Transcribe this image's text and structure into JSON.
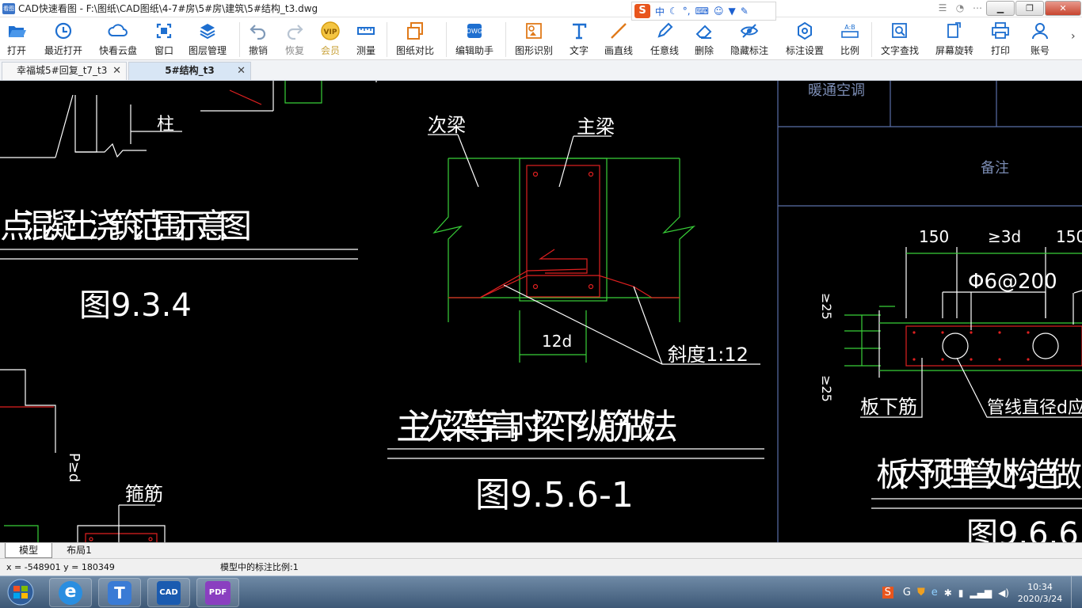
{
  "window": {
    "title": "CAD快速看图 - F:\\图纸\\CAD图纸\\4-7#房\\5#房\\建筑\\5#结构_t3.dwg",
    "app_logo": "看图"
  },
  "ime": {
    "logo": "S",
    "mode": "中"
  },
  "toolbar": {
    "items": [
      {
        "label": "打开",
        "icon": "folder-open-icon"
      },
      {
        "label": "最近打开",
        "icon": "recent-icon"
      },
      {
        "label": "快看云盘",
        "icon": "cloud-icon"
      },
      {
        "label": "窗口",
        "icon": "window-icon"
      },
      {
        "label": "图层管理",
        "icon": "layers-icon"
      },
      {
        "label": "撤销",
        "icon": "undo-icon"
      },
      {
        "label": "恢复",
        "icon": "redo-icon"
      },
      {
        "label": "会员",
        "icon": "vip-icon",
        "badge": "VIP"
      },
      {
        "label": "测量",
        "icon": "ruler-icon"
      },
      {
        "label": "图纸对比",
        "icon": "compare-icon"
      },
      {
        "label": "编辑助手",
        "icon": "edit-assistant-icon"
      },
      {
        "label": "图形识别",
        "icon": "shape-recognize-icon"
      },
      {
        "label": "文字",
        "icon": "text-icon"
      },
      {
        "label": "画直线",
        "icon": "line-icon"
      },
      {
        "label": "任意线",
        "icon": "pen-icon"
      },
      {
        "label": "删除",
        "icon": "eraser-icon"
      },
      {
        "label": "隐藏标注",
        "icon": "hide-icon"
      },
      {
        "label": "标注设置",
        "icon": "settings-icon"
      },
      {
        "label": "比例",
        "icon": "scale-icon",
        "badge": "A:B"
      },
      {
        "label": "文字查找",
        "icon": "text-search-icon"
      },
      {
        "label": "屏幕旋转",
        "icon": "rotate-icon"
      },
      {
        "label": "打印",
        "icon": "print-icon"
      },
      {
        "label": "账号",
        "icon": "account-icon"
      }
    ]
  },
  "tabs": [
    {
      "label": "幸福城5#回复_t7_t3",
      "active": false
    },
    {
      "label": "5#结构_t3",
      "active": true
    }
  ],
  "drawing": {
    "left_title": "点混凝土浇筑范围示意图",
    "left_fig": "图9.3.4",
    "column_label": "柱",
    "stirrup_label": "箍筋",
    "side_label": "P≥d",
    "secondary_beam": "次梁",
    "main_beam": "主梁",
    "dim_12d": "12d",
    "slope": "斜度1:12",
    "center_title": "主次梁等高时梁下纵筋做法",
    "center_fig": "图9.5.6-1",
    "hvac": "暖通空调",
    "remarks": "备注",
    "dim_150_left": "150",
    "dim_3d": "≥3d",
    "dim_150_right": "150",
    "rebar_spec": "Φ6@200",
    "dim_25_top": "≥25",
    "dim_25_bottom": "≥25",
    "slab_bottom_bar": "板下筋",
    "pipe_note": "管线直径d应≤",
    "right_title": "板内预埋管处构造做",
    "right_fig": "图9.6.6"
  },
  "layout_tabs": [
    {
      "label": "模型",
      "active": true
    },
    {
      "label": "布局1",
      "active": false
    }
  ],
  "status": {
    "coords": "x = -548901  y = 180349",
    "scale_text": "模型中的标注比例:1"
  },
  "taskbar": {
    "apps": [
      {
        "name": "ie",
        "label": "e"
      },
      {
        "name": "tool",
        "label": "T"
      },
      {
        "name": "cad",
        "label": "CAD"
      },
      {
        "name": "pdf",
        "label": "PDF"
      }
    ],
    "time": "10:34",
    "date": "2020/3/24"
  },
  "colors": {
    "cad_red": "#e02020",
    "cad_green": "#38d038",
    "cad_white": "#ffffff",
    "cad_blue": "#5a6fa8"
  }
}
